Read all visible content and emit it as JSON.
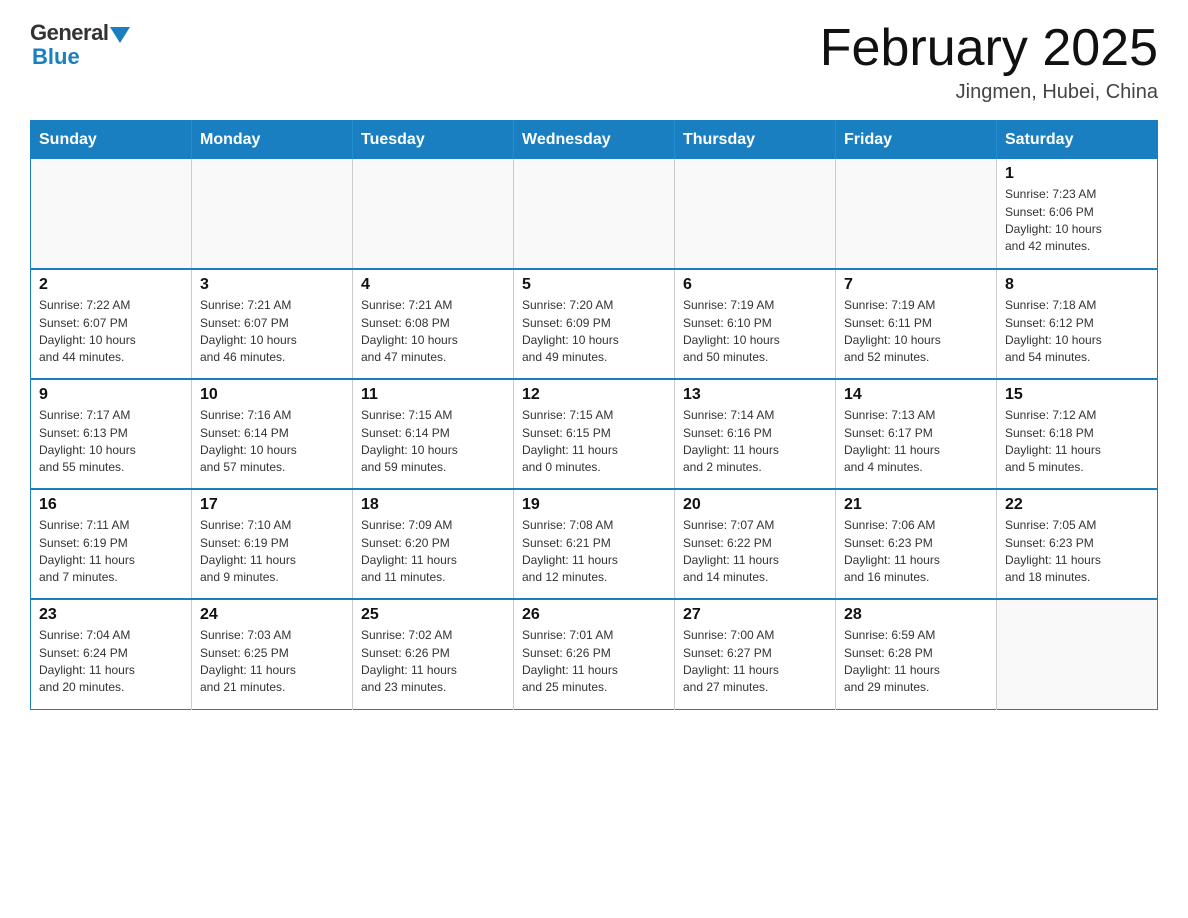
{
  "logo": {
    "general": "General",
    "blue": "Blue"
  },
  "title": "February 2025",
  "subtitle": "Jingmen, Hubei, China",
  "weekdays": [
    "Sunday",
    "Monday",
    "Tuesday",
    "Wednesday",
    "Thursday",
    "Friday",
    "Saturday"
  ],
  "weeks": [
    [
      {
        "day": "",
        "info": ""
      },
      {
        "day": "",
        "info": ""
      },
      {
        "day": "",
        "info": ""
      },
      {
        "day": "",
        "info": ""
      },
      {
        "day": "",
        "info": ""
      },
      {
        "day": "",
        "info": ""
      },
      {
        "day": "1",
        "info": "Sunrise: 7:23 AM\nSunset: 6:06 PM\nDaylight: 10 hours\nand 42 minutes."
      }
    ],
    [
      {
        "day": "2",
        "info": "Sunrise: 7:22 AM\nSunset: 6:07 PM\nDaylight: 10 hours\nand 44 minutes."
      },
      {
        "day": "3",
        "info": "Sunrise: 7:21 AM\nSunset: 6:07 PM\nDaylight: 10 hours\nand 46 minutes."
      },
      {
        "day": "4",
        "info": "Sunrise: 7:21 AM\nSunset: 6:08 PM\nDaylight: 10 hours\nand 47 minutes."
      },
      {
        "day": "5",
        "info": "Sunrise: 7:20 AM\nSunset: 6:09 PM\nDaylight: 10 hours\nand 49 minutes."
      },
      {
        "day": "6",
        "info": "Sunrise: 7:19 AM\nSunset: 6:10 PM\nDaylight: 10 hours\nand 50 minutes."
      },
      {
        "day": "7",
        "info": "Sunrise: 7:19 AM\nSunset: 6:11 PM\nDaylight: 10 hours\nand 52 minutes."
      },
      {
        "day": "8",
        "info": "Sunrise: 7:18 AM\nSunset: 6:12 PM\nDaylight: 10 hours\nand 54 minutes."
      }
    ],
    [
      {
        "day": "9",
        "info": "Sunrise: 7:17 AM\nSunset: 6:13 PM\nDaylight: 10 hours\nand 55 minutes."
      },
      {
        "day": "10",
        "info": "Sunrise: 7:16 AM\nSunset: 6:14 PM\nDaylight: 10 hours\nand 57 minutes."
      },
      {
        "day": "11",
        "info": "Sunrise: 7:15 AM\nSunset: 6:14 PM\nDaylight: 10 hours\nand 59 minutes."
      },
      {
        "day": "12",
        "info": "Sunrise: 7:15 AM\nSunset: 6:15 PM\nDaylight: 11 hours\nand 0 minutes."
      },
      {
        "day": "13",
        "info": "Sunrise: 7:14 AM\nSunset: 6:16 PM\nDaylight: 11 hours\nand 2 minutes."
      },
      {
        "day": "14",
        "info": "Sunrise: 7:13 AM\nSunset: 6:17 PM\nDaylight: 11 hours\nand 4 minutes."
      },
      {
        "day": "15",
        "info": "Sunrise: 7:12 AM\nSunset: 6:18 PM\nDaylight: 11 hours\nand 5 minutes."
      }
    ],
    [
      {
        "day": "16",
        "info": "Sunrise: 7:11 AM\nSunset: 6:19 PM\nDaylight: 11 hours\nand 7 minutes."
      },
      {
        "day": "17",
        "info": "Sunrise: 7:10 AM\nSunset: 6:19 PM\nDaylight: 11 hours\nand 9 minutes."
      },
      {
        "day": "18",
        "info": "Sunrise: 7:09 AM\nSunset: 6:20 PM\nDaylight: 11 hours\nand 11 minutes."
      },
      {
        "day": "19",
        "info": "Sunrise: 7:08 AM\nSunset: 6:21 PM\nDaylight: 11 hours\nand 12 minutes."
      },
      {
        "day": "20",
        "info": "Sunrise: 7:07 AM\nSunset: 6:22 PM\nDaylight: 11 hours\nand 14 minutes."
      },
      {
        "day": "21",
        "info": "Sunrise: 7:06 AM\nSunset: 6:23 PM\nDaylight: 11 hours\nand 16 minutes."
      },
      {
        "day": "22",
        "info": "Sunrise: 7:05 AM\nSunset: 6:23 PM\nDaylight: 11 hours\nand 18 minutes."
      }
    ],
    [
      {
        "day": "23",
        "info": "Sunrise: 7:04 AM\nSunset: 6:24 PM\nDaylight: 11 hours\nand 20 minutes."
      },
      {
        "day": "24",
        "info": "Sunrise: 7:03 AM\nSunset: 6:25 PM\nDaylight: 11 hours\nand 21 minutes."
      },
      {
        "day": "25",
        "info": "Sunrise: 7:02 AM\nSunset: 6:26 PM\nDaylight: 11 hours\nand 23 minutes."
      },
      {
        "day": "26",
        "info": "Sunrise: 7:01 AM\nSunset: 6:26 PM\nDaylight: 11 hours\nand 25 minutes."
      },
      {
        "day": "27",
        "info": "Sunrise: 7:00 AM\nSunset: 6:27 PM\nDaylight: 11 hours\nand 27 minutes."
      },
      {
        "day": "28",
        "info": "Sunrise: 6:59 AM\nSunset: 6:28 PM\nDaylight: 11 hours\nand 29 minutes."
      },
      {
        "day": "",
        "info": ""
      }
    ]
  ]
}
